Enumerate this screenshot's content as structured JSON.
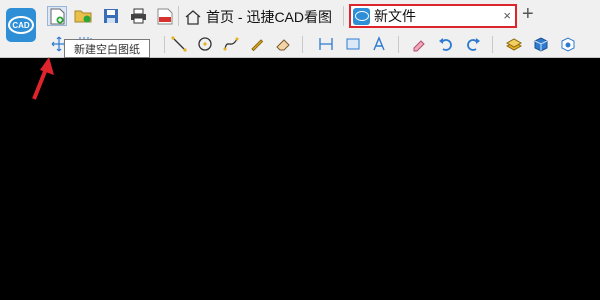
{
  "app": {
    "logo_text": "CAD",
    "home_tab": {
      "label": "首页 - 迅捷CAD看图",
      "icon": "home-icon"
    },
    "active_tab": {
      "label": "新文件",
      "close": "×",
      "icon": "cad-file-icon"
    },
    "new_tab_symbol": "+"
  },
  "quick_access": [
    {
      "name": "new-blank-drawing",
      "icon": "new-file-icon"
    },
    {
      "name": "open",
      "icon": "folder-open-icon"
    },
    {
      "name": "save",
      "icon": "save-icon"
    },
    {
      "name": "print",
      "icon": "print-icon"
    },
    {
      "name": "export-pdf",
      "icon": "pdf-export-icon"
    }
  ],
  "tooltip": {
    "text": "新建空白图纸"
  },
  "toolbar": [
    "pan-icon",
    "zoom-icon",
    "line-icon",
    "circle-icon",
    "curve-icon",
    "pencil-icon",
    "eraser-icon",
    "ruler-icon",
    "area-measure-icon",
    "text-icon",
    "highlighter-icon",
    "undo-icon",
    "redo-icon",
    "layer-icon",
    "3d-box-icon",
    "settings-box-icon"
  ],
  "colors": {
    "accent": "#2e8fd6",
    "highlight_border": "#e0242c",
    "arrow": "#e0242c"
  }
}
